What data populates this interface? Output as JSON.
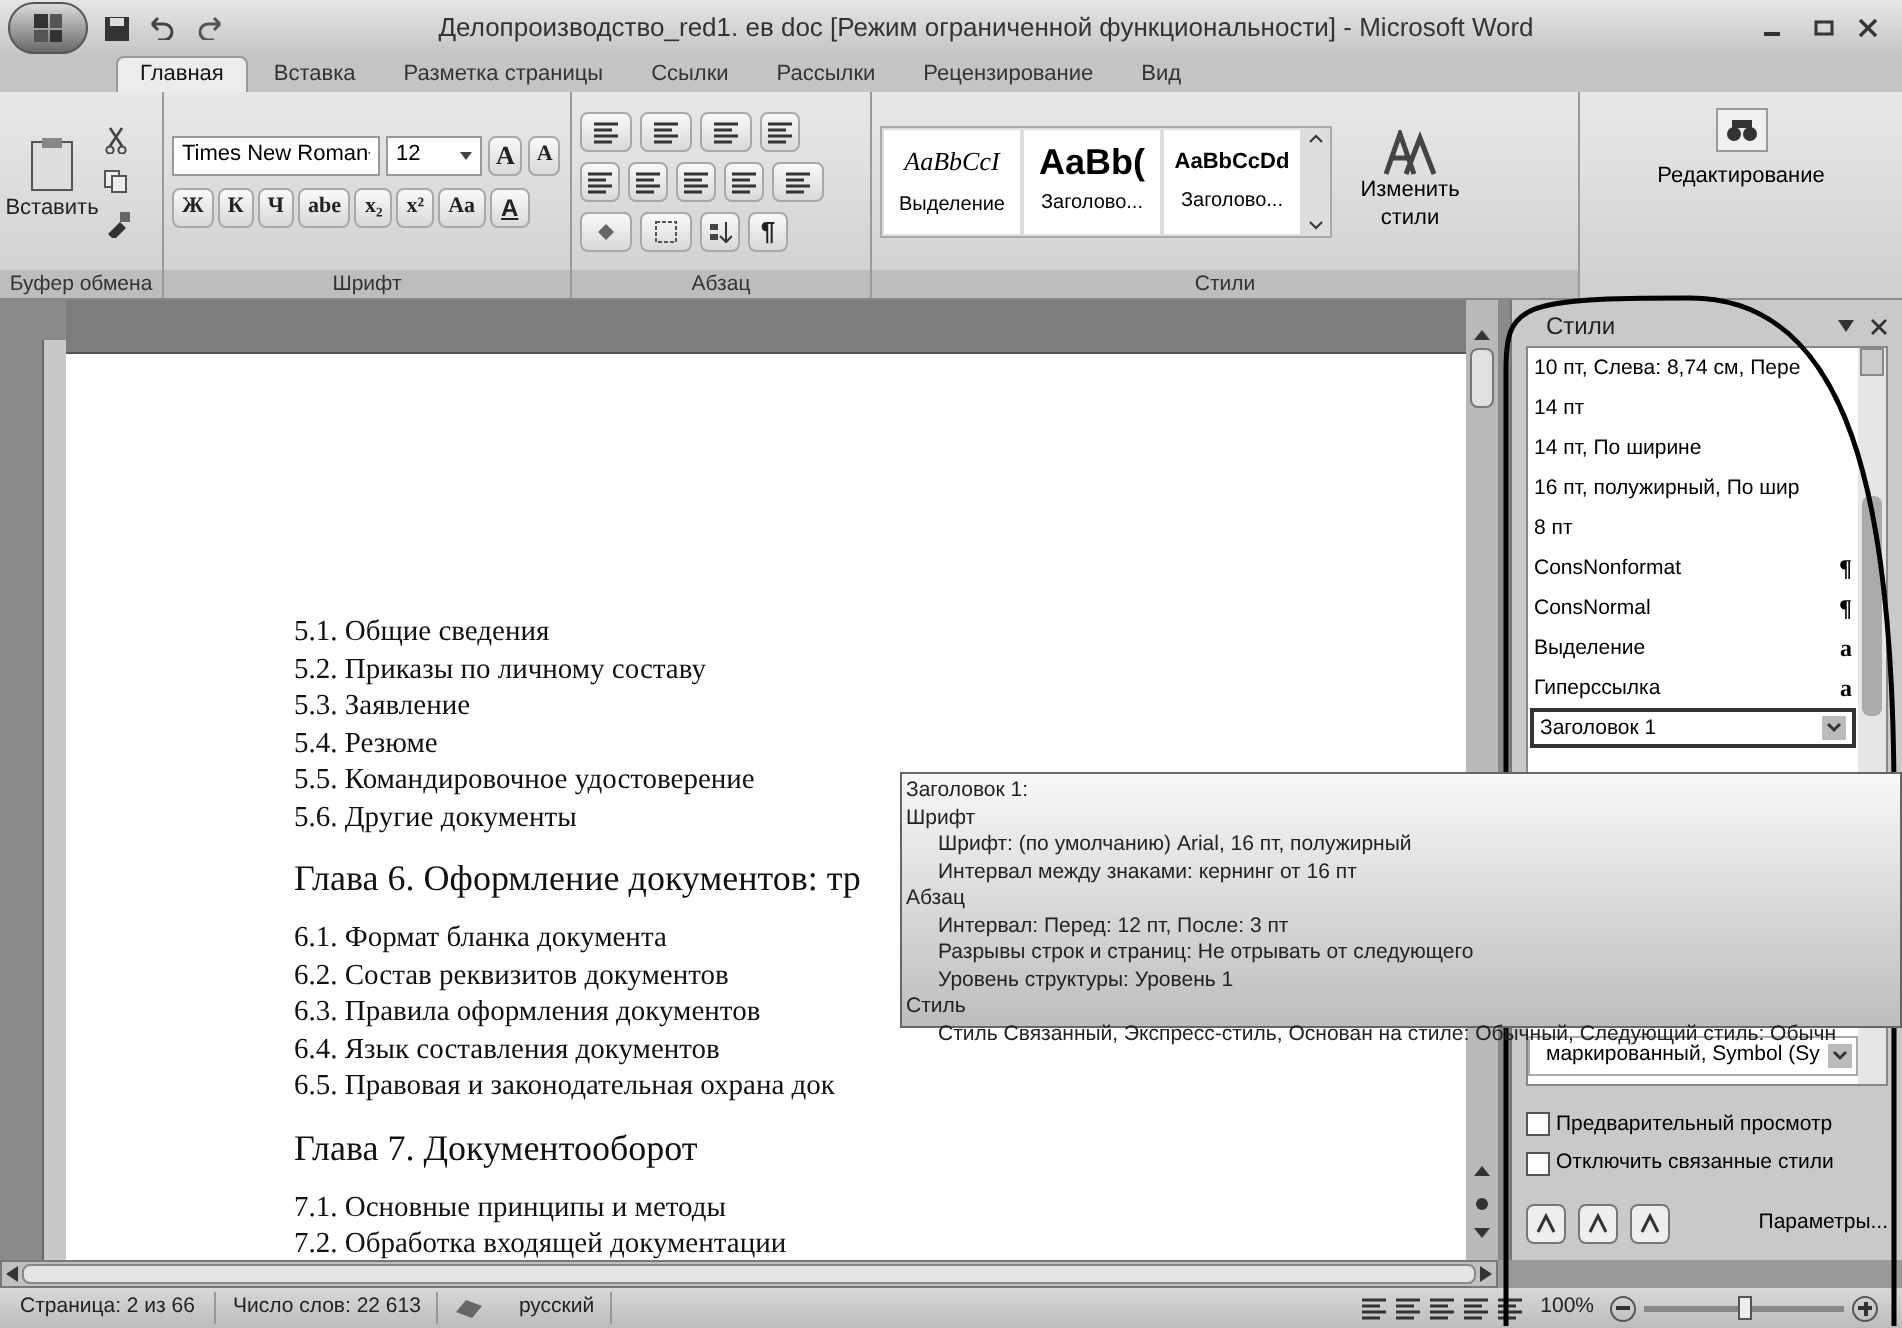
{
  "window": {
    "title": "Делопроизводство_red1. ев doc [Режим ограниченной функциональности] - Microsoft Word"
  },
  "ribbon_tabs": [
    {
      "label": "Главная",
      "selected": true
    },
    {
      "label": "Вставка",
      "selected": false
    },
    {
      "label": "Разметка страницы",
      "selected": false
    },
    {
      "label": "Ссылки",
      "selected": false
    },
    {
      "label": "Рассылки",
      "selected": false
    },
    {
      "label": "Рецензирование",
      "selected": false
    },
    {
      "label": "Вид",
      "selected": false
    }
  ],
  "ribbon": {
    "clipboard": {
      "paste": "Вставить",
      "group": "Буфер обмена"
    },
    "font": {
      "name": "Times New Roman",
      "size": "12",
      "grow": "A",
      "shrink": "A",
      "format_buttons": [
        "Ж",
        "К",
        "Ч",
        "abe",
        "x₂",
        "x²",
        "Aa"
      ],
      "color_button": "A",
      "group": "Шрифт"
    },
    "paragraph": {
      "pilcrow": "¶",
      "group": "Абзац"
    },
    "styles": {
      "gallery": [
        {
          "sample": "AaBbCcI",
          "label": "Выделение",
          "kind": "italic"
        },
        {
          "sample": "AaBb(",
          "label": "Заголово...",
          "kind": "heading"
        },
        {
          "sample": "AaBbCcDd",
          "label": "Заголово...",
          "kind": "bold"
        }
      ],
      "change_styles": "Изменить стили",
      "group": "Стили"
    },
    "editing": {
      "label": "Редактирование"
    }
  },
  "document": {
    "lines": [
      {
        "kind": "item",
        "text": "5.1. Общие сведения"
      },
      {
        "kind": "item",
        "text": "5.2. Приказы по личному составу"
      },
      {
        "kind": "item",
        "text": "5.3. Заявление"
      },
      {
        "kind": "item",
        "text": "5.4. Резюме"
      },
      {
        "kind": "item",
        "text": "5.5. Командировочное удостоверение"
      },
      {
        "kind": "item",
        "text": "5.6. Другие документы"
      },
      {
        "kind": "heading",
        "text": "Глава 6. Оформление документов: тр"
      },
      {
        "kind": "item",
        "text": "6.1. Формат бланка документа"
      },
      {
        "kind": "item",
        "text": "6.2. Состав реквизитов документов"
      },
      {
        "kind": "item",
        "text": "6.3. Правила оформления документов"
      },
      {
        "kind": "item",
        "text": "6.4. Язык составления документов"
      },
      {
        "kind": "item",
        "text": "6.5. Правовая и законодательная охрана док"
      },
      {
        "kind": "heading",
        "text": "Глава 7. Документооборот"
      },
      {
        "kind": "item",
        "text": "7.1. Основные принципы и методы"
      },
      {
        "kind": "item",
        "text": "7.2. Обработка входящей документации"
      }
    ]
  },
  "styles_pane": {
    "title": "Стили",
    "items": [
      {
        "label": "10 пт, Слева:  8,74 см, Пере",
        "selected": false
      },
      {
        "label": "14 пт",
        "selected": false
      },
      {
        "label": "14 пт, По ширине",
        "selected": false
      },
      {
        "label": "16 пт, полужирный, По шир",
        "selected": false
      },
      {
        "label": "8 пт",
        "selected": false
      },
      {
        "label": "ConsNonformat",
        "type_mark": "¶",
        "selected": false
      },
      {
        "label": "ConsNormal",
        "type_mark": "¶",
        "selected": false
      },
      {
        "label": "Выделение",
        "type_mark": "a",
        "selected": false
      },
      {
        "label": "Гиперссылка",
        "type_mark": "a",
        "selected": false
      },
      {
        "label": "Заголовок 1",
        "selected": true
      }
    ],
    "last_item": {
      "label": "маркированный, Symbol (Sy",
      "selected": false
    },
    "checkboxes": [
      {
        "label": "Предварительный просмотр",
        "checked": false
      },
      {
        "label": "Отключить связанные стили",
        "checked": false
      }
    ],
    "options_link": "Параметры..."
  },
  "tooltip": {
    "title": "Заголовок 1:",
    "sections": [
      {
        "heading": "Шрифт",
        "lines": [
          "Шрифт:  (по умолчанию) Arial, 16 пт, полужирный",
          "Интервал между знаками:  кернинг от 16 пт"
        ]
      },
      {
        "heading": "Абзац",
        "lines": [
          "Интервал:  Перед:  12 пт, После:  3 пт",
          "Разрывы строк и страниц:  Не отрывать от следующего",
          "Уровень структуры:  Уровень 1"
        ]
      },
      {
        "heading": "Стиль",
        "lines": [
          "Стиль Связанный, Экспресс-стиль, Основан на стиле: Обычный, Следующий стиль: Обычн"
        ]
      }
    ]
  },
  "status_bar": {
    "page": "Страница: 2 из 66",
    "words": "Число слов: 22 613",
    "language": "русский",
    "zoom": "100%",
    "zoom_slider": {
      "level": 0.5
    }
  }
}
